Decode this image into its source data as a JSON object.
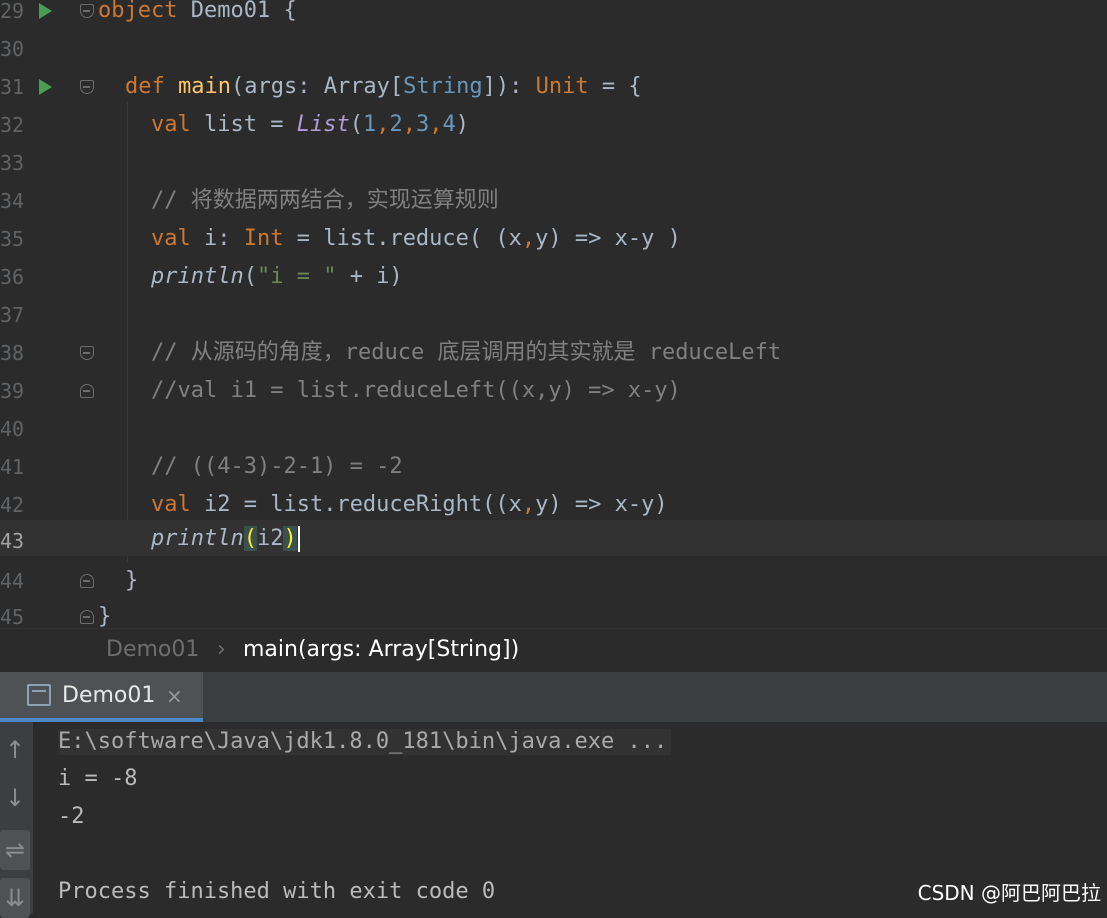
{
  "editor": {
    "line_numbers": [
      "29",
      "30",
      "31",
      "32",
      "33",
      "34",
      "35",
      "36",
      "37",
      "38",
      "39",
      "40",
      "41",
      "42",
      "43",
      "44",
      "45"
    ],
    "line29": {
      "kw": "object",
      "name": " Demo01 {"
    },
    "line31": {
      "kw_def": "def",
      "fn": "main",
      "p1": "(args: Array[",
      "type": "String",
      "p2": "]): ",
      "unit": "Unit",
      "p3": " = {"
    },
    "line32": {
      "kw": "val",
      "p1": " list = ",
      "list": "List",
      "p2": "(",
      "n1": "1",
      "n2": "2",
      "n3": "3",
      "n4": "4",
      "p3": ")",
      "comma": ","
    },
    "line34": "// 将数据两两结合，实现运算规则",
    "line35": {
      "kw": "val",
      "p1": " i: ",
      "int": "Int",
      "p2": " = list.reduce( (x",
      "comma": ",",
      "p3": "y) => x-y )"
    },
    "line36": {
      "fn": "println",
      "p1": "(",
      "str": "\"i = \"",
      "p2": " + i)"
    },
    "line38": "// 从源码的角度，reduce 底层调用的其实就是 reduceLeft",
    "line39": "//val i1 = list.reduceLeft((x,y) => x-y)",
    "line41": "// ((4-3)-2-1) = -2",
    "line42": {
      "kw": "val",
      "p1": " i2 = list.reduceRight((x",
      "comma": ",",
      "p2": "y) => x-y)"
    },
    "line43": {
      "fn": "println",
      "open": "(",
      "arg": "i2",
      "close": ")"
    },
    "line44": "}",
    "line45": "}"
  },
  "breadcrumb": {
    "object": "Demo01",
    "separator": "›",
    "method": "main(args: Array[String])"
  },
  "run_window": {
    "tab_label": "Demo01",
    "close_symbol": "×",
    "side_icons": {
      "up": "↑",
      "down": "↓",
      "wrap": "⇌",
      "scroll": "⇊"
    },
    "console_lines": [
      "E:\\software\\Java\\jdk1.8.0_181\\bin\\java.exe ...",
      "i = -8",
      "-2",
      "",
      "Process finished with exit code 0"
    ]
  },
  "watermark": "CSDN @阿巴阿巴拉",
  "colors": {
    "keyword": "#cc7832",
    "function": "#ffc66d",
    "number": "#6897bb",
    "comment": "#808080",
    "string": "#6a8759",
    "run_icon": "#499c54"
  }
}
